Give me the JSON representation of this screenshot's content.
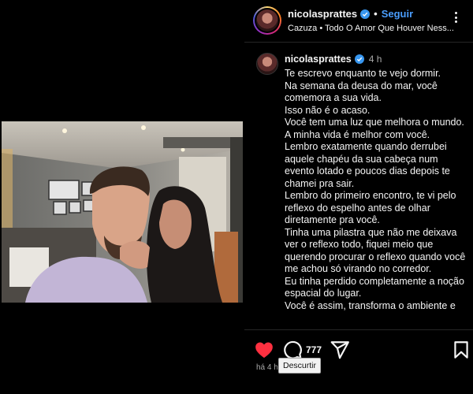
{
  "header": {
    "username": "nicolasprattes",
    "follow_label": "Seguir",
    "separator": "•",
    "song": "Cazuza • Todo O Amor Que Houver Ness..."
  },
  "caption": {
    "username": "nicolasprattes",
    "time": "4 h",
    "lines": [
      "Te escrevo enquanto te vejo dormir.",
      "Na semana da deusa do mar, você comemora a sua vida.",
      "Isso não é o acaso.",
      "Você tem uma luz que melhora o mundo.",
      "A minha vida é melhor com você.",
      "Lembro exatamente quando derrubei aquele chapéu da sua cabeça num evento lotado e poucos dias depois te chamei pra sair.",
      "Lembro do primeiro encontro, te vi pelo reflexo do espelho antes de olhar diretamente pra você.",
      "Tinha uma pilastra que não me deixava ver o reflexo todo, fiquei meio que querendo procurar o reflexo quando você me achou só virando no corredor.",
      "Eu tinha perdido completamente a noção espacial do lugar.",
      "Você é assim, transforma o ambiente e"
    ]
  },
  "actions": {
    "comment_count": "777",
    "time_ago": "há 4 h",
    "tooltip": "Descurtir",
    "like_color": "#ff3040",
    "like_state": "liked"
  },
  "colors": {
    "background": "#000000",
    "accent": "#4a9dfc",
    "verified": "#3897f0"
  },
  "icons": [
    "verified-badge-icon",
    "more-options-icon",
    "heart-filled-icon",
    "comment-icon",
    "share-icon",
    "bookmark-icon"
  ]
}
